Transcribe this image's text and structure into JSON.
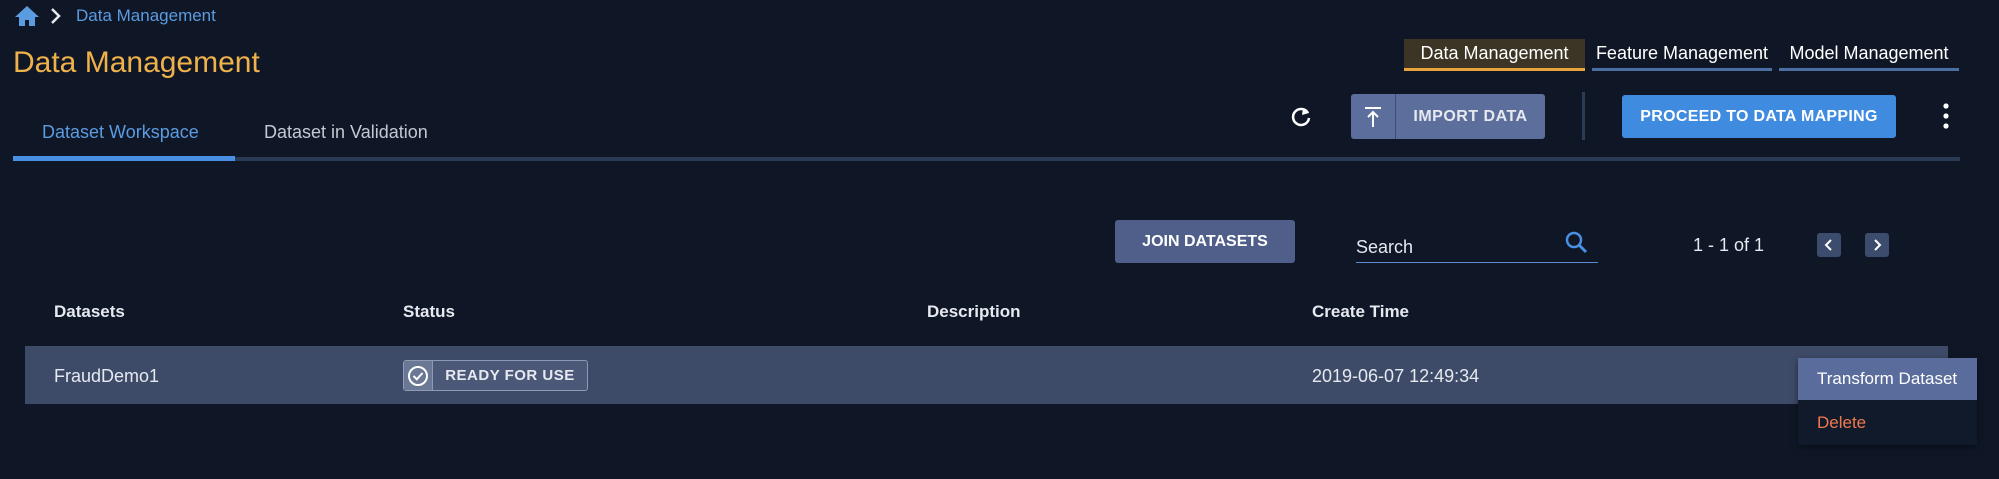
{
  "breadcrumb": {
    "home_icon": "home-icon",
    "separator_icon": "chevron-right-icon",
    "current": "Data Management"
  },
  "page_title": "Data Management",
  "top_nav": {
    "items": [
      {
        "label": "Data Management",
        "active": true
      },
      {
        "label": "Feature Management",
        "active": false
      },
      {
        "label": "Model Management",
        "active": false
      }
    ]
  },
  "tabs": [
    {
      "label": "Dataset Workspace",
      "active": true
    },
    {
      "label": "Dataset in Validation",
      "active": false
    }
  ],
  "toolbar": {
    "refresh_icon": "refresh-icon",
    "import_label": "IMPORT DATA",
    "import_icon": "upload-icon",
    "proceed_label": "PROCEED TO DATA MAPPING",
    "more_icon": "more-vertical-icon"
  },
  "list_controls": {
    "join_label": "JOIN DATASETS",
    "search_placeholder": "Search",
    "search_icon": "search-icon",
    "pager_text": "1 - 1 of 1",
    "prev_icon": "chevron-left-icon",
    "next_icon": "chevron-right-icon"
  },
  "table": {
    "columns": [
      "Datasets",
      "Status",
      "Description",
      "Create Time"
    ],
    "rows": [
      {
        "dataset": "FraudDemo1",
        "status": "READY FOR USE",
        "description": "",
        "create_time": "2019-06-07 12:49:34"
      }
    ]
  },
  "context_menu": {
    "items": [
      "Transform Dataset",
      "Delete"
    ]
  },
  "colors": {
    "background": "#0f1727",
    "title_accent": "#efb14a",
    "link_blue": "#5b9be0",
    "primary_button": "#3f8be0",
    "delete_text": "#f07a4d"
  }
}
